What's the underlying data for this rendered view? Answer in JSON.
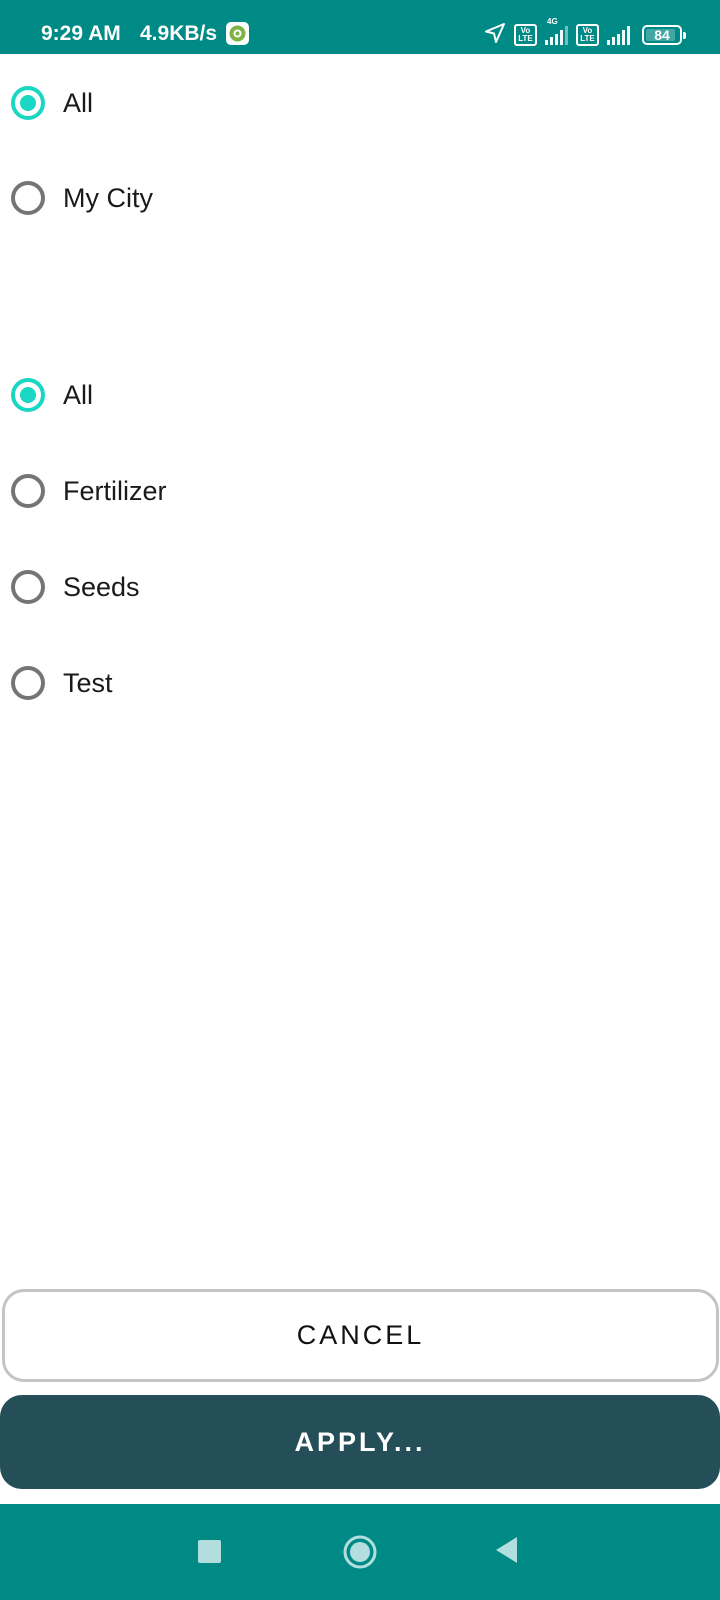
{
  "status_bar": {
    "time": "9:29 AM",
    "network_speed": "4.9KB/s",
    "volte_label": "Vo\nLTE",
    "network_type": "4G",
    "battery_level": "84",
    "icons": [
      "app-notification-icon",
      "location-arrow-icon",
      "volte-icon",
      "signal-icon",
      "volte-icon",
      "signal-icon",
      "battery-icon"
    ]
  },
  "location_filter": {
    "options": [
      {
        "label": "All",
        "selected": true
      },
      {
        "label": "My City",
        "selected": false
      }
    ]
  },
  "category_filter": {
    "options": [
      {
        "label": "All",
        "selected": true
      },
      {
        "label": "Fertilizer",
        "selected": false
      },
      {
        "label": "Seeds",
        "selected": false
      },
      {
        "label": "Test",
        "selected": false
      }
    ]
  },
  "actions": {
    "cancel_label": "CANCEL",
    "apply_label": "APPLY..."
  },
  "nav_bar": {
    "icons": [
      "recents-square-icon",
      "home-circle-icon",
      "back-triangle-icon"
    ]
  },
  "colors": {
    "status_bar": "#008a85",
    "radio_checked": "#19d7c3",
    "radio_unchecked": "#757575",
    "apply_button": "#254f58",
    "cancel_border": "#c4c4c4"
  }
}
